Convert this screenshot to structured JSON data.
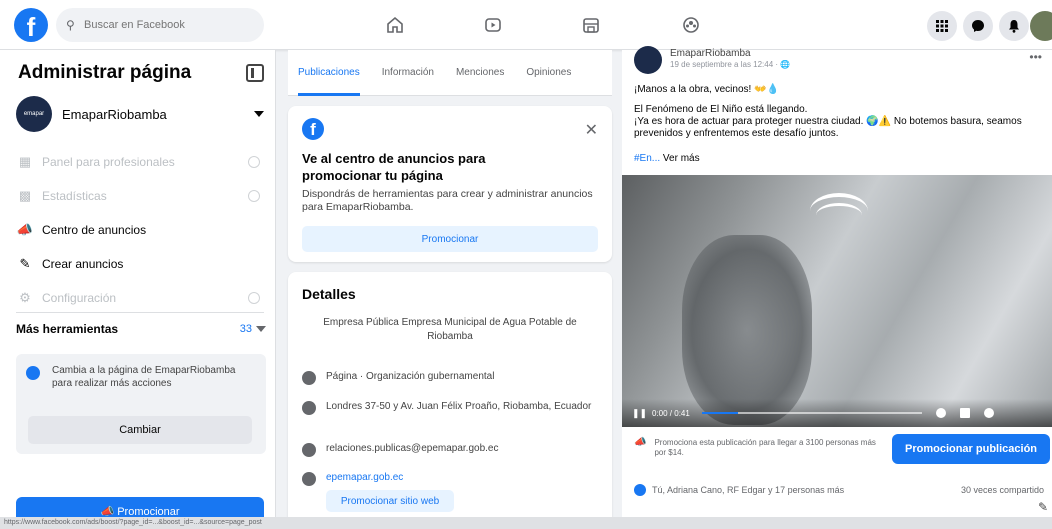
{
  "topbar": {
    "search_placeholder": "Buscar en Facebook",
    "icons": [
      "home-icon",
      "video-icon",
      "marketplace-icon",
      "groups-icon",
      "menu-grid-icon",
      "messenger-icon",
      "notifications-icon"
    ]
  },
  "left": {
    "title": "Administrar página",
    "page_name": "EmaparRiobamba",
    "avatar_text": "emapar",
    "menu": [
      {
        "label": "Panel para profesionales",
        "enabled": false
      },
      {
        "label": "Estadísticas",
        "enabled": false
      },
      {
        "label": "Centro de anuncios",
        "enabled": true
      },
      {
        "label": "Crear anuncios",
        "enabled": true
      },
      {
        "label": "Configuración",
        "enabled": false
      }
    ],
    "tools_label": "Más herramientas",
    "tools_count": "33",
    "switch_text": "Cambia a la página de EmaparRiobamba para realizar más acciones",
    "switch_button": "Cambiar",
    "promote_button": "Promocionar"
  },
  "tabs": [
    "Publicaciones",
    "Información",
    "Menciones",
    "Opiniones"
  ],
  "ad_card": {
    "title": "Ve al centro de anuncios para promocionar tu página",
    "desc": "Dispondrás de herramientas para crear y administrar anuncios para EmaparRiobamba.",
    "button": "Promocionar"
  },
  "details": {
    "title": "Detalles",
    "about": "Empresa Pública Empresa Municipal de Agua Potable de Riobamba",
    "rows": [
      "Página · Organización gubernamental",
      "Londres 37-50 y Av. Juan Félix Proaño, Riobamba, Ecuador",
      "relaciones.publicas@epemapar.gob.ec",
      "epemapar.gob.ec"
    ],
    "web_button": "Promocionar sitio web"
  },
  "post": {
    "author": "EmaparRiobamba",
    "time": "19 de septiembre a las 12:44 · 🌐",
    "line1": "¡Manos a la obra, vecinos! 👐💧",
    "line2": "El Fenómeno de El Niño está llegando.",
    "line3": "¡Ya es hora de actuar para proteger nuestra ciudad. 🌍⚠️ No botemos basura, seamos prevenidos y enfrentemos este desafío juntos.",
    "tag": "#En...",
    "see_more": "Ver más",
    "video_time": "0:00 / 0:41",
    "boost_text": "Promociona esta publicación para llegar a 3100 personas más por $14.",
    "boost_button": "Promocionar publicación",
    "reactions": "Tú, Adriana Cano, RF Edgar y 17 personas más",
    "shares": "30 veces compartido"
  },
  "statusbar": "https://www.facebook.com/ads/boost/?page_id=...&boost_id=...&source=page_post"
}
